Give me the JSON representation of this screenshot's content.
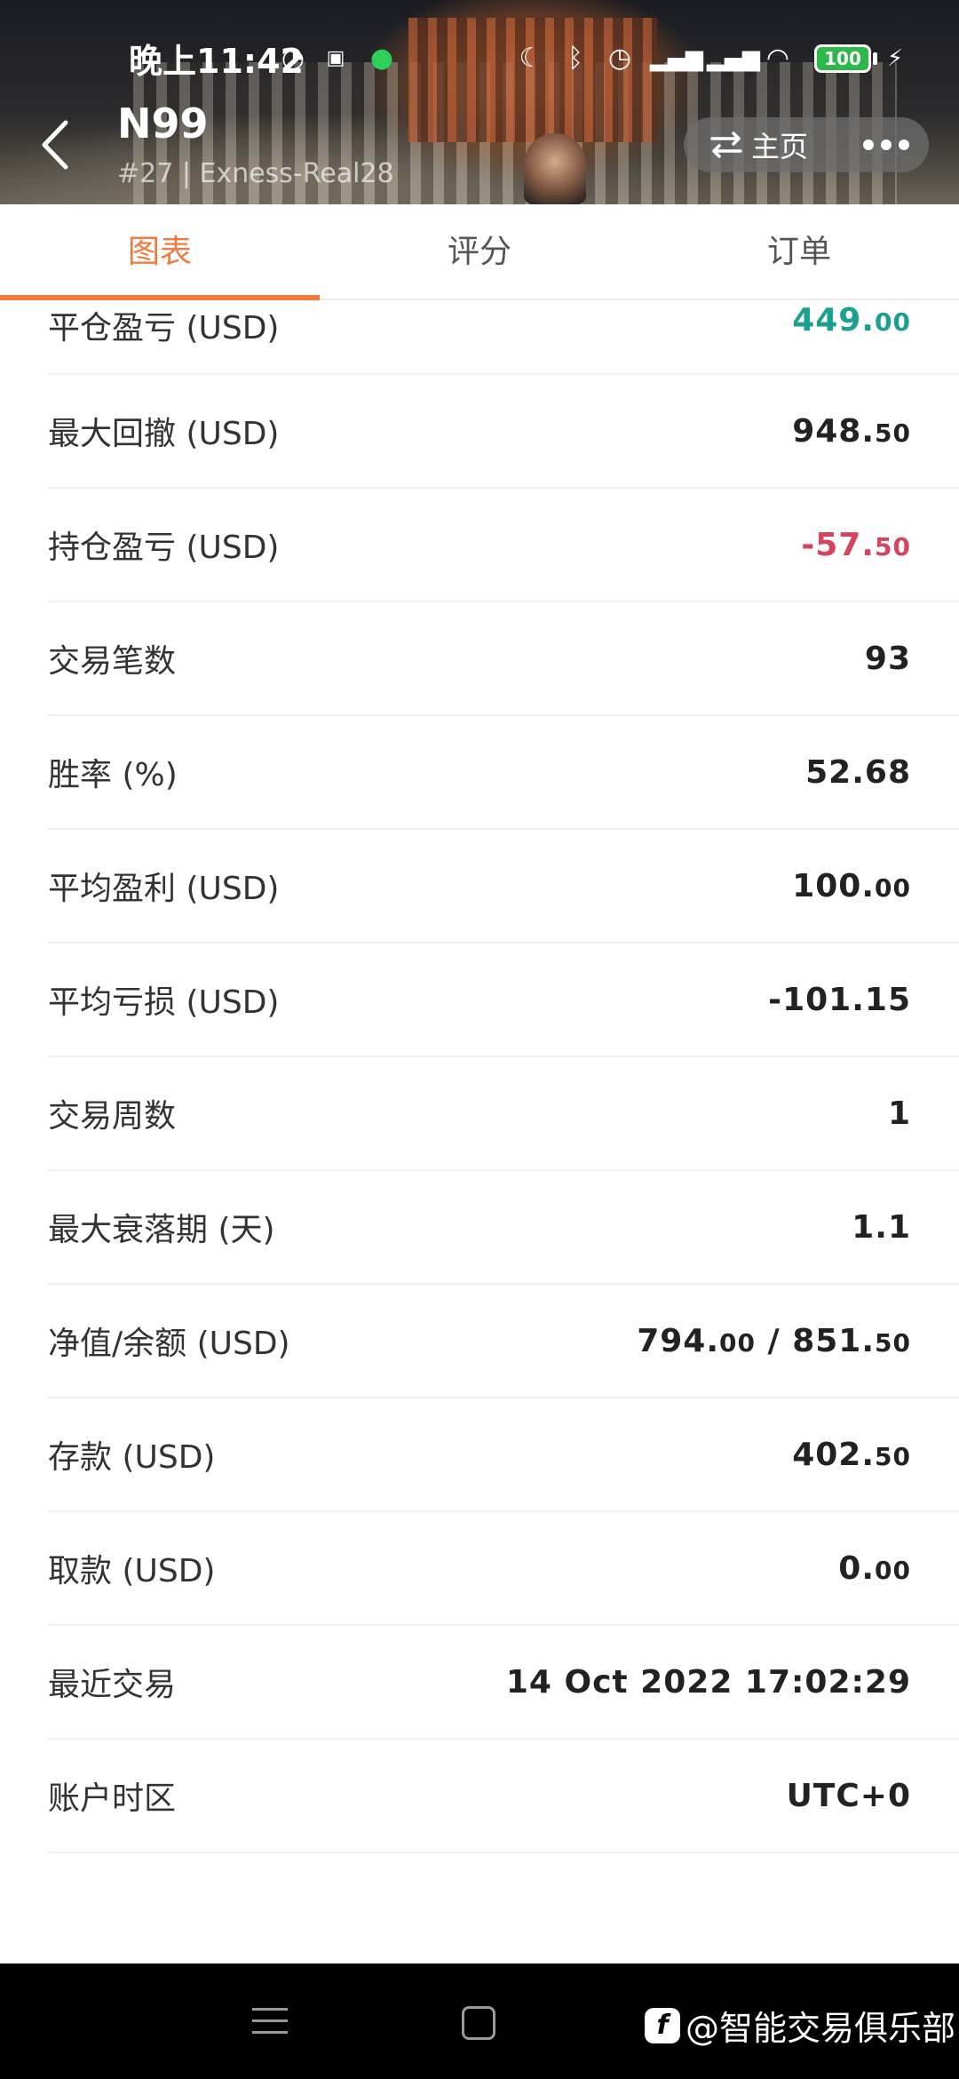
{
  "status_bar": {
    "time": "晚上11:42",
    "battery": "100"
  },
  "header": {
    "title": "N99",
    "subtitle": "#27 | Exness-Real28",
    "home_label": "主页"
  },
  "tabs": [
    {
      "label": "图表",
      "active": true
    },
    {
      "label": "评分",
      "active": false
    },
    {
      "label": "订单",
      "active": false
    }
  ],
  "stats": [
    {
      "label": "平仓盈亏 (USD)",
      "int": "449.",
      "dec": "00",
      "tone": "pos"
    },
    {
      "label": "最大回撤 (USD)",
      "int": "948.",
      "dec": "50",
      "tone": ""
    },
    {
      "label": "持仓盈亏 (USD)",
      "int": "-57.",
      "dec": "50",
      "tone": "neg"
    },
    {
      "label": "交易笔数",
      "int": "93",
      "dec": "",
      "tone": ""
    },
    {
      "label": "胜率 (%)",
      "int": "52.68",
      "dec": "",
      "tone": ""
    },
    {
      "label": "平均盈利 (USD)",
      "int": "100.",
      "dec": "00",
      "tone": ""
    },
    {
      "label": "平均亏损 (USD)",
      "int": "-101.15",
      "dec": "",
      "tone": ""
    },
    {
      "label": "交易周数",
      "int": "1",
      "dec": "",
      "tone": ""
    },
    {
      "label": "最大衰落期 (天)",
      "int": "1.1",
      "dec": "",
      "tone": ""
    },
    {
      "label": "净值/余额 (USD)",
      "int": "794.",
      "dec": "00",
      "int2": " / 851.",
      "dec2": "50",
      "tone": ""
    },
    {
      "label": "存款 (USD)",
      "int": "402.",
      "dec": "50",
      "tone": ""
    },
    {
      "label": "取款 (USD)",
      "int": "0.",
      "dec": "00",
      "tone": ""
    },
    {
      "label": "最近交易",
      "int": "14 Oct 2022 17:02:29",
      "dec": "",
      "tone": ""
    },
    {
      "label": "账户时区",
      "int": "UTC+0",
      "dec": "",
      "tone": ""
    }
  ],
  "watermark": "@智能交易俱乐部",
  "colors": {
    "accent": "#f07b3f",
    "positive": "#1aa08e",
    "negative": "#d6435d"
  }
}
